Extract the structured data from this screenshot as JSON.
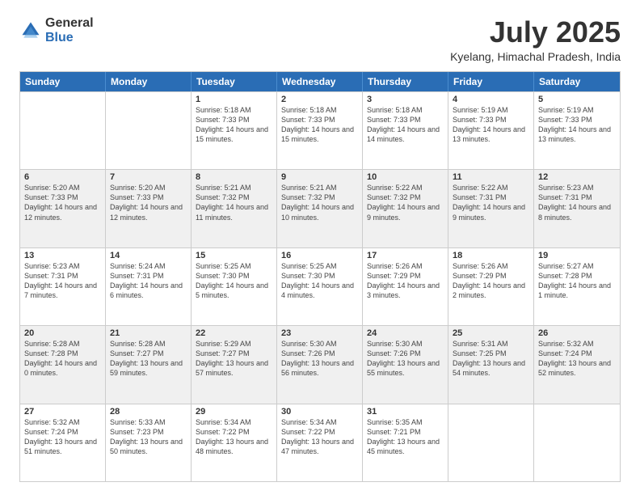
{
  "logo": {
    "general": "General",
    "blue": "Blue"
  },
  "title": "July 2025",
  "location": "Kyelang, Himachal Pradesh, India",
  "headers": [
    "Sunday",
    "Monday",
    "Tuesday",
    "Wednesday",
    "Thursday",
    "Friday",
    "Saturday"
  ],
  "rows": [
    [
      {
        "day": "",
        "text": ""
      },
      {
        "day": "",
        "text": ""
      },
      {
        "day": "1",
        "text": "Sunrise: 5:18 AM\nSunset: 7:33 PM\nDaylight: 14 hours and 15 minutes."
      },
      {
        "day": "2",
        "text": "Sunrise: 5:18 AM\nSunset: 7:33 PM\nDaylight: 14 hours and 15 minutes."
      },
      {
        "day": "3",
        "text": "Sunrise: 5:18 AM\nSunset: 7:33 PM\nDaylight: 14 hours and 14 minutes."
      },
      {
        "day": "4",
        "text": "Sunrise: 5:19 AM\nSunset: 7:33 PM\nDaylight: 14 hours and 13 minutes."
      },
      {
        "day": "5",
        "text": "Sunrise: 5:19 AM\nSunset: 7:33 PM\nDaylight: 14 hours and 13 minutes."
      }
    ],
    [
      {
        "day": "6",
        "text": "Sunrise: 5:20 AM\nSunset: 7:33 PM\nDaylight: 14 hours and 12 minutes."
      },
      {
        "day": "7",
        "text": "Sunrise: 5:20 AM\nSunset: 7:33 PM\nDaylight: 14 hours and 12 minutes."
      },
      {
        "day": "8",
        "text": "Sunrise: 5:21 AM\nSunset: 7:32 PM\nDaylight: 14 hours and 11 minutes."
      },
      {
        "day": "9",
        "text": "Sunrise: 5:21 AM\nSunset: 7:32 PM\nDaylight: 14 hours and 10 minutes."
      },
      {
        "day": "10",
        "text": "Sunrise: 5:22 AM\nSunset: 7:32 PM\nDaylight: 14 hours and 9 minutes."
      },
      {
        "day": "11",
        "text": "Sunrise: 5:22 AM\nSunset: 7:31 PM\nDaylight: 14 hours and 9 minutes."
      },
      {
        "day": "12",
        "text": "Sunrise: 5:23 AM\nSunset: 7:31 PM\nDaylight: 14 hours and 8 minutes."
      }
    ],
    [
      {
        "day": "13",
        "text": "Sunrise: 5:23 AM\nSunset: 7:31 PM\nDaylight: 14 hours and 7 minutes."
      },
      {
        "day": "14",
        "text": "Sunrise: 5:24 AM\nSunset: 7:31 PM\nDaylight: 14 hours and 6 minutes."
      },
      {
        "day": "15",
        "text": "Sunrise: 5:25 AM\nSunset: 7:30 PM\nDaylight: 14 hours and 5 minutes."
      },
      {
        "day": "16",
        "text": "Sunrise: 5:25 AM\nSunset: 7:30 PM\nDaylight: 14 hours and 4 minutes."
      },
      {
        "day": "17",
        "text": "Sunrise: 5:26 AM\nSunset: 7:29 PM\nDaylight: 14 hours and 3 minutes."
      },
      {
        "day": "18",
        "text": "Sunrise: 5:26 AM\nSunset: 7:29 PM\nDaylight: 14 hours and 2 minutes."
      },
      {
        "day": "19",
        "text": "Sunrise: 5:27 AM\nSunset: 7:28 PM\nDaylight: 14 hours and 1 minute."
      }
    ],
    [
      {
        "day": "20",
        "text": "Sunrise: 5:28 AM\nSunset: 7:28 PM\nDaylight: 14 hours and 0 minutes."
      },
      {
        "day": "21",
        "text": "Sunrise: 5:28 AM\nSunset: 7:27 PM\nDaylight: 13 hours and 59 minutes."
      },
      {
        "day": "22",
        "text": "Sunrise: 5:29 AM\nSunset: 7:27 PM\nDaylight: 13 hours and 57 minutes."
      },
      {
        "day": "23",
        "text": "Sunrise: 5:30 AM\nSunset: 7:26 PM\nDaylight: 13 hours and 56 minutes."
      },
      {
        "day": "24",
        "text": "Sunrise: 5:30 AM\nSunset: 7:26 PM\nDaylight: 13 hours and 55 minutes."
      },
      {
        "day": "25",
        "text": "Sunrise: 5:31 AM\nSunset: 7:25 PM\nDaylight: 13 hours and 54 minutes."
      },
      {
        "day": "26",
        "text": "Sunrise: 5:32 AM\nSunset: 7:24 PM\nDaylight: 13 hours and 52 minutes."
      }
    ],
    [
      {
        "day": "27",
        "text": "Sunrise: 5:32 AM\nSunset: 7:24 PM\nDaylight: 13 hours and 51 minutes."
      },
      {
        "day": "28",
        "text": "Sunrise: 5:33 AM\nSunset: 7:23 PM\nDaylight: 13 hours and 50 minutes."
      },
      {
        "day": "29",
        "text": "Sunrise: 5:34 AM\nSunset: 7:22 PM\nDaylight: 13 hours and 48 minutes."
      },
      {
        "day": "30",
        "text": "Sunrise: 5:34 AM\nSunset: 7:22 PM\nDaylight: 13 hours and 47 minutes."
      },
      {
        "day": "31",
        "text": "Sunrise: 5:35 AM\nSunset: 7:21 PM\nDaylight: 13 hours and 45 minutes."
      },
      {
        "day": "",
        "text": ""
      },
      {
        "day": "",
        "text": ""
      }
    ]
  ]
}
